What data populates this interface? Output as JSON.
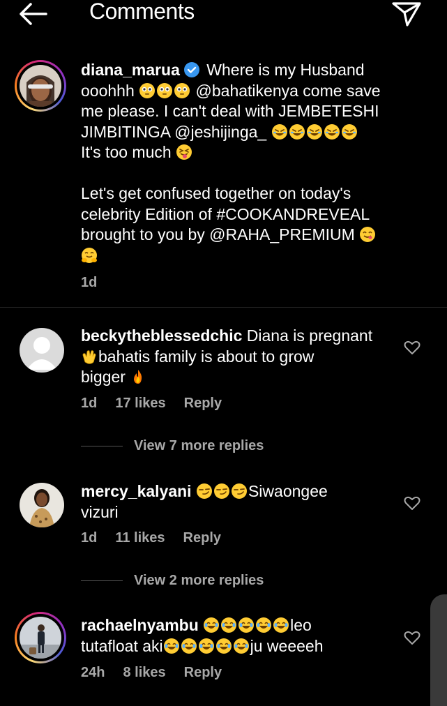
{
  "header": {
    "title": "Comments"
  },
  "caption": {
    "username": "diana_marua",
    "line1": "Where is my Husband",
    "line2_a": "ooohhh",
    "line2_b": "@bahatikenya come save",
    "line3": "me please. I can't deal with JEMBETESHI",
    "line4": "JIMBITINGA @jeshijinga_",
    "line5": "It's too much",
    "line6": "Let's get confused together on today's",
    "line7": "celebrity Edition of #COOKANDREVEAL",
    "line8": "brought to you by @RAHA_PREMIUM",
    "time": "1d"
  },
  "comments": [
    {
      "username": "beckytheblessedchic",
      "line1": "Diana is pregnant",
      "line2": "bahatis family is about to grow",
      "line3": "bigger",
      "time": "1d",
      "likes": "17 likes",
      "reply": "Reply",
      "more_replies": "View 7 more replies"
    },
    {
      "username": "mercy_kalyani",
      "line1": "Siwaongee",
      "line2": "vizuri",
      "time": "1d",
      "likes": "11 likes",
      "reply": "Reply",
      "more_replies": "View 2 more replies"
    },
    {
      "username": "rachaelnyambu",
      "line1": "leo",
      "line2_a": "tutafloat aki",
      "line2_b": "ju weeeeh",
      "time": "24h",
      "likes": "8 likes",
      "reply": "Reply"
    }
  ],
  "icons": {
    "back": "arrow-left-icon",
    "send": "paper-plane-icon",
    "like": "heart-outline-icon",
    "verified": "verified-badge-icon"
  },
  "colors": {
    "verified": "#3897f0",
    "meta": "#a8a8a8",
    "background": "#000000"
  }
}
